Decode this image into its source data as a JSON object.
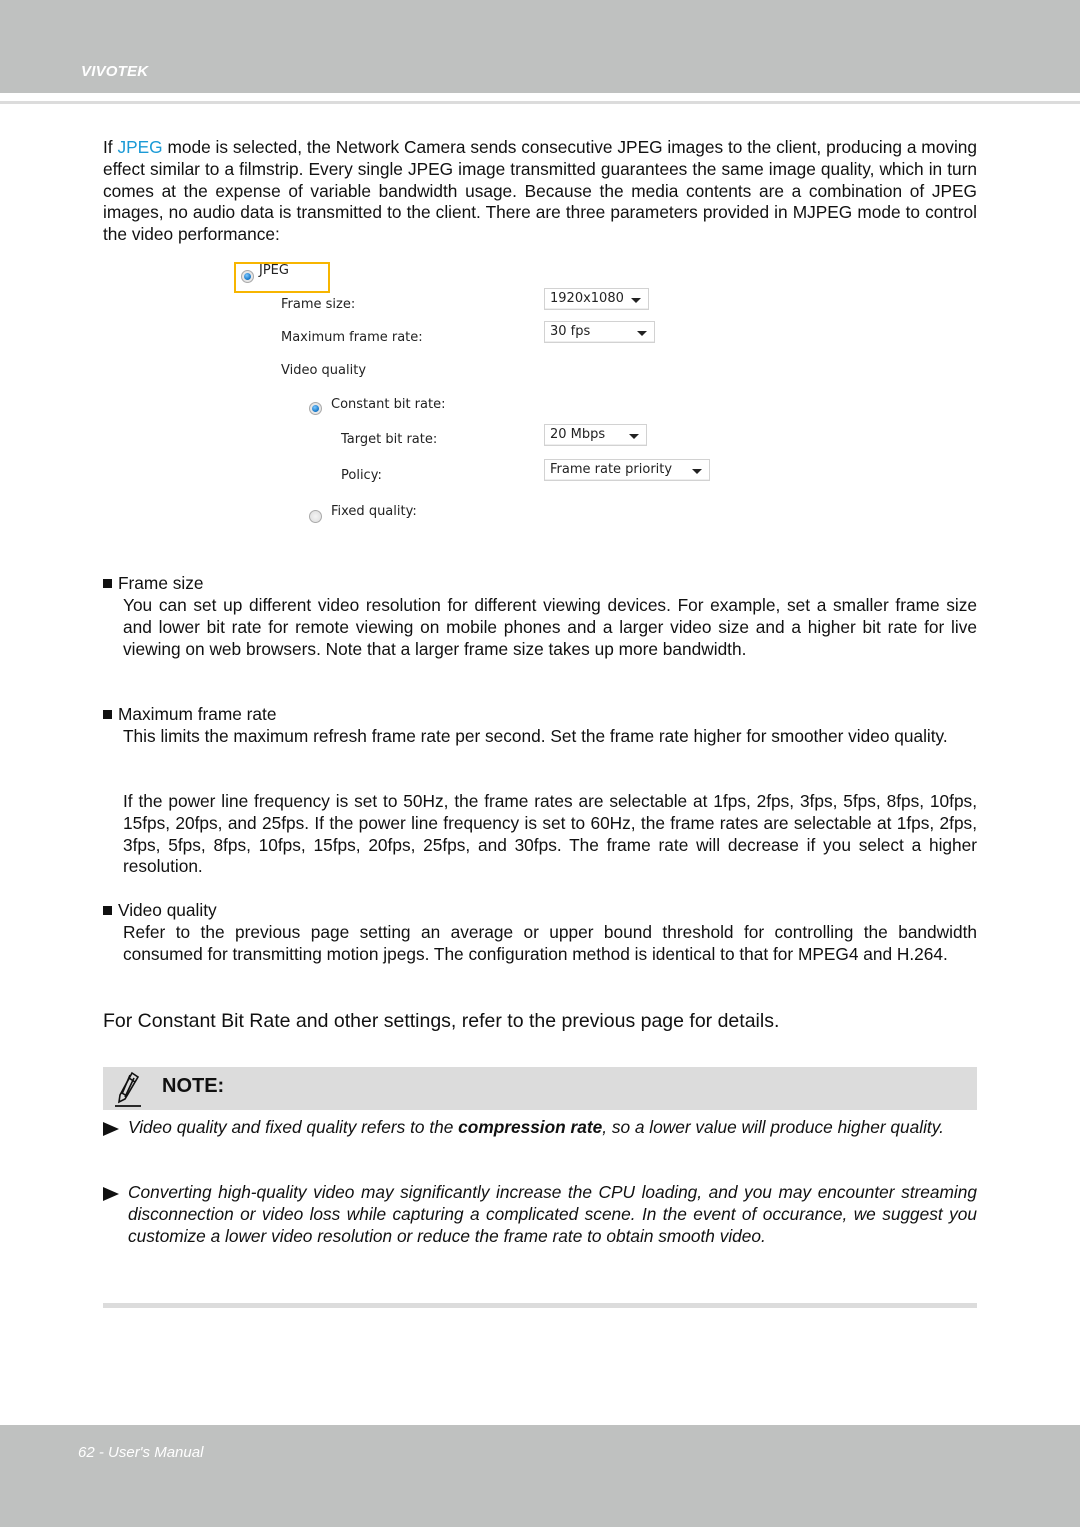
{
  "header": {
    "brand": "VIVOTEK"
  },
  "intro": {
    "prefix": "If ",
    "highlight": "JPEG",
    "rest": " mode is selected, the Network Camera sends consecutive JPEG images to the client, producing a moving effect similar to a filmstrip. Every single JPEG image transmitted guarantees the same image quality, which in turn comes at the expense of variable bandwidth usage. Because the media contents are a combination of JPEG images, no audio data is transmitted to the client. There are three parameters provided in MJPEG mode to control the video performance:"
  },
  "ui": {
    "mode_label": "JPEG",
    "mode_selected": true,
    "frame_size_label": "Frame size:",
    "frame_size_value": "1920x1080",
    "max_frame_rate_label": "Maximum frame rate:",
    "max_frame_rate_value": "30 fps",
    "video_quality_label": "Video quality",
    "cbr_label": "Constant bit rate:",
    "cbr_selected": true,
    "target_bit_rate_label": "Target bit rate:",
    "target_bit_rate_value": "20 Mbps",
    "policy_label": "Policy:",
    "policy_value": "Frame rate priority",
    "fixed_quality_label": "Fixed quality:",
    "fixed_quality_selected": false,
    "highlight_color": "#f7b500"
  },
  "sections": [
    {
      "heading": "Frame size",
      "paragraphs": [
        "You can set up different video resolution for different viewing devices. For example, set a smaller frame size and lower bit rate for remote viewing on mobile phones and a larger video size and a higher bit rate for live viewing on web browsers. Note that a larger frame size takes up more bandwidth."
      ]
    },
    {
      "heading": "Maximum frame rate",
      "paragraphs": [
        "This limits the maximum refresh frame rate per second. Set the frame rate higher for smoother video quality.",
        "If the power line frequency is set to 50Hz, the frame rates are selectable at 1fps, 2fps, 3fps, 5fps, 8fps, 10fps, 15fps, 20fps, and 25fps. If the power line frequency is set to 60Hz, the frame rates are selectable at 1fps, 2fps, 3fps, 5fps, 8fps, 10fps, 15fps, 20fps, 25fps, and 30fps. The frame rate will decrease if you select a higher resolution."
      ]
    },
    {
      "heading": "Video quality",
      "paragraphs": [
        "Refer to the previous page setting an average or upper bound threshold for controlling the bandwidth consumed for transmitting motion jpegs. The configuration method is identical to that for MPEG4 and H.264."
      ]
    }
  ],
  "summary": "For Constant Bit Rate and other settings, refer to the previous page for details.",
  "note": {
    "label": "NOTE:",
    "items": [
      {
        "before": "Video quality and fixed quality refers to the ",
        "bold": "compression rate",
        "after": ", so a lower value will produce higher quality."
      },
      {
        "before": "Converting high-quality video may significantly increase the CPU loading, and you may encounter streaming disconnection or video loss while capturing a complicated scene. In the event of occurance, we suggest you customize a lower video resolution or reduce the frame rate to obtain smooth video.",
        "bold": "",
        "after": ""
      }
    ]
  },
  "footer": {
    "page_label": "62 - User's Manual"
  },
  "colors": {
    "accent": "#1b9ad6",
    "band": "#bfc1c0",
    "note_bg": "#dcdcdc"
  }
}
